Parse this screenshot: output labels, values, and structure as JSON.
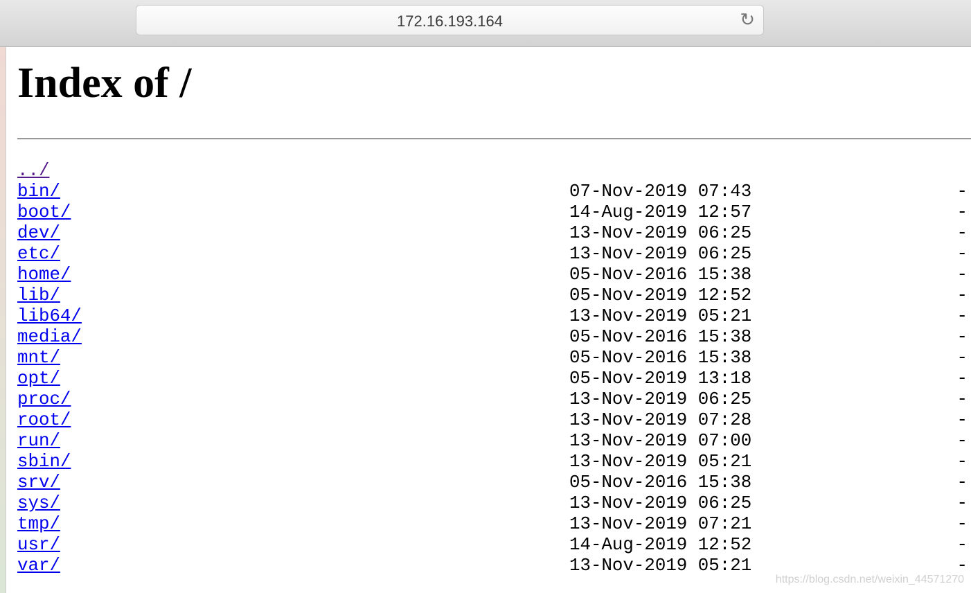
{
  "browser": {
    "url": "172.16.193.164",
    "reload_icon": "reload-icon"
  },
  "page": {
    "title": "Index of /",
    "parent": "../",
    "entries": [
      {
        "name": "bin/",
        "date": "07-Nov-2019 07:43",
        "size": "-"
      },
      {
        "name": "boot/",
        "date": "14-Aug-2019 12:57",
        "size": "-"
      },
      {
        "name": "dev/",
        "date": "13-Nov-2019 06:25",
        "size": "-"
      },
      {
        "name": "etc/",
        "date": "13-Nov-2019 06:25",
        "size": "-"
      },
      {
        "name": "home/",
        "date": "05-Nov-2016 15:38",
        "size": "-"
      },
      {
        "name": "lib/",
        "date": "05-Nov-2019 12:52",
        "size": "-"
      },
      {
        "name": "lib64/",
        "date": "13-Nov-2019 05:21",
        "size": "-"
      },
      {
        "name": "media/",
        "date": "05-Nov-2016 15:38",
        "size": "-"
      },
      {
        "name": "mnt/",
        "date": "05-Nov-2016 15:38",
        "size": "-"
      },
      {
        "name": "opt/",
        "date": "05-Nov-2019 13:18",
        "size": "-"
      },
      {
        "name": "proc/",
        "date": "13-Nov-2019 06:25",
        "size": "-"
      },
      {
        "name": "root/",
        "date": "13-Nov-2019 07:28",
        "size": "-"
      },
      {
        "name": "run/",
        "date": "13-Nov-2019 07:00",
        "size": "-"
      },
      {
        "name": "sbin/",
        "date": "13-Nov-2019 05:21",
        "size": "-"
      },
      {
        "name": "srv/",
        "date": "05-Nov-2016 15:38",
        "size": "-"
      },
      {
        "name": "sys/",
        "date": "13-Nov-2019 06:25",
        "size": "-"
      },
      {
        "name": "tmp/",
        "date": "13-Nov-2019 07:21",
        "size": "-"
      },
      {
        "name": "usr/",
        "date": "14-Aug-2019 12:52",
        "size": "-"
      },
      {
        "name": "var/",
        "date": "13-Nov-2019 05:21",
        "size": "-"
      }
    ]
  },
  "watermark": "https://blog.csdn.net/weixin_44571270"
}
